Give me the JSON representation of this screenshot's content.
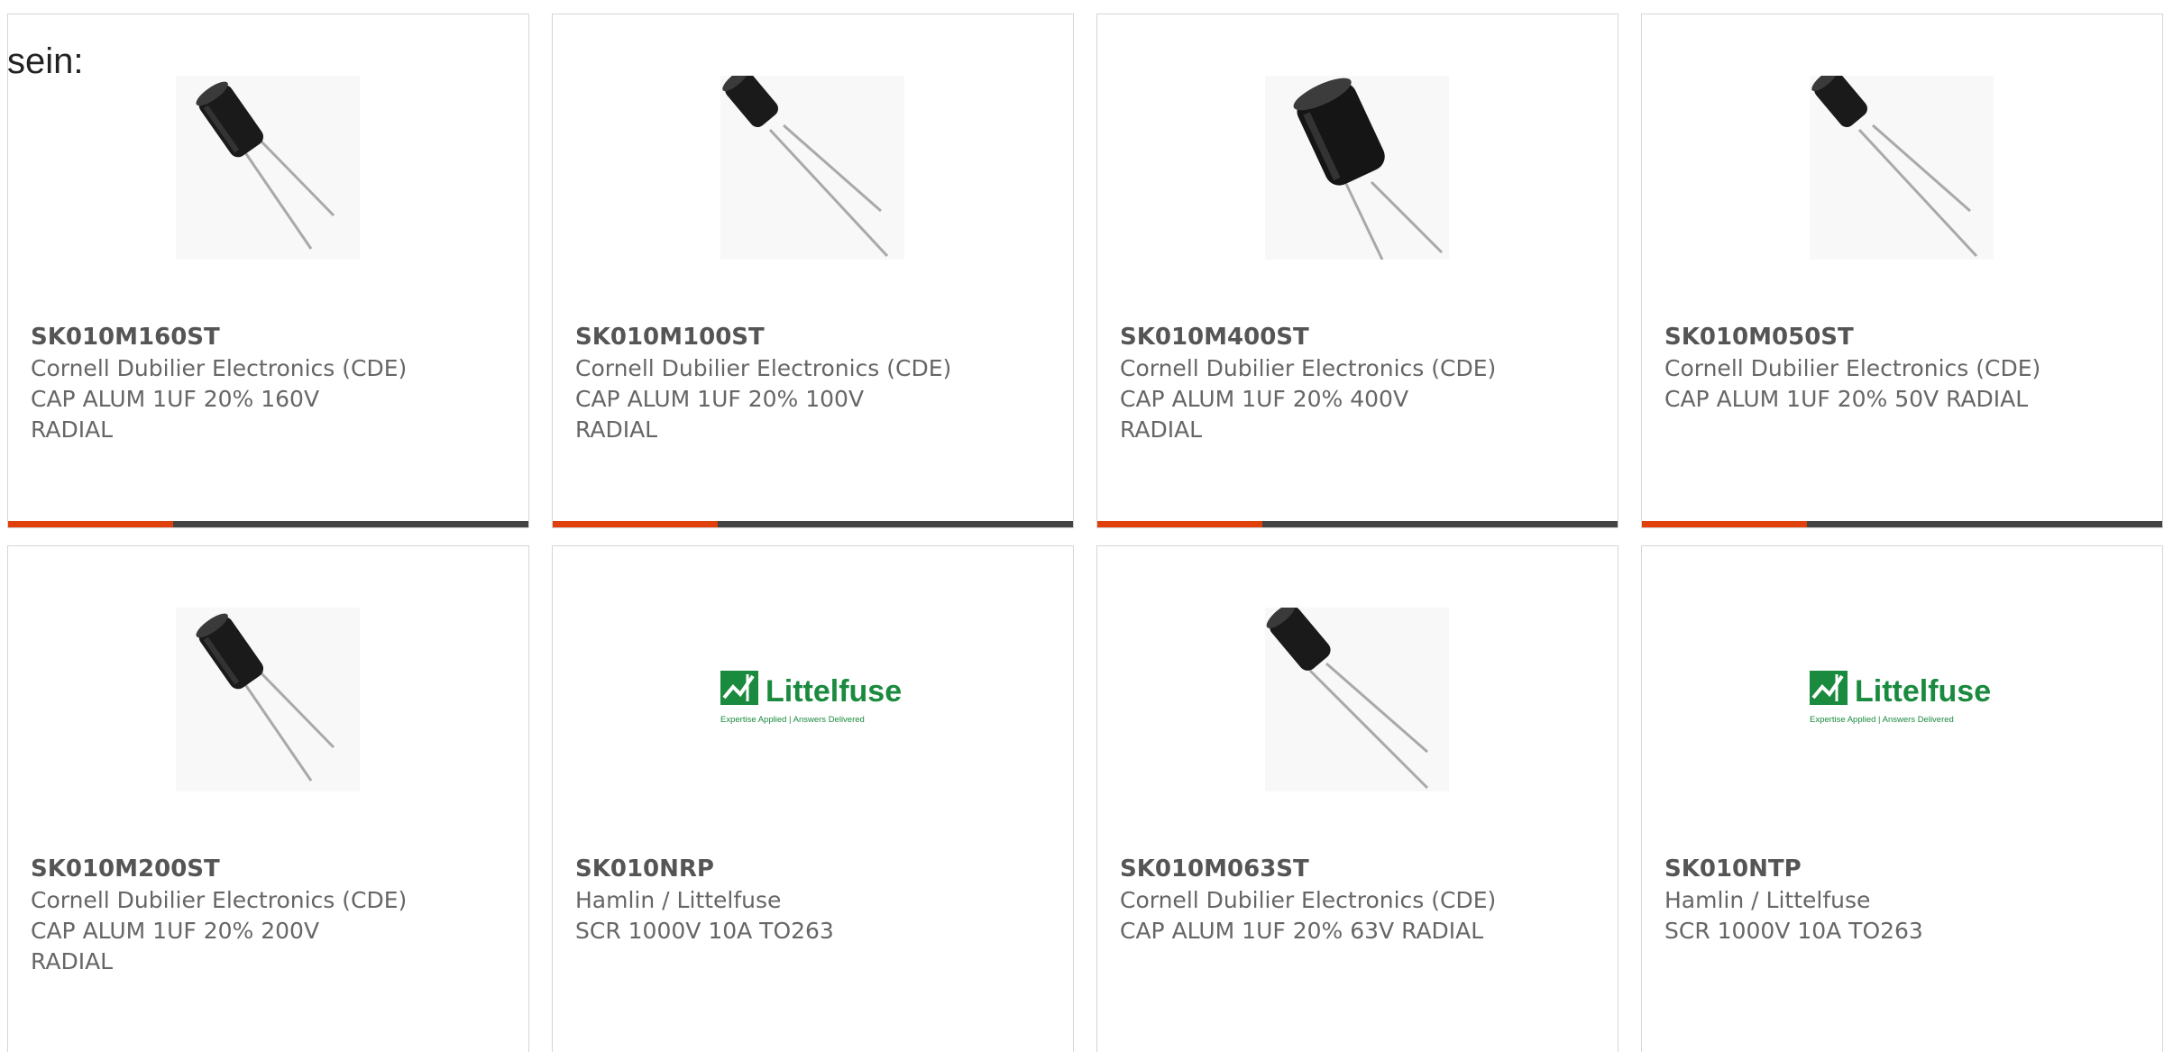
{
  "intro_text": "sein:",
  "colors": {
    "accent": "#e0400c",
    "bar_dark": "#444444",
    "logo_green": "#1a8a3e"
  },
  "cards": [
    {
      "part_number": "SK010M160ST",
      "manufacturer": "Cornell Dubilier Electronics (CDE)",
      "desc_line1": "CAP ALUM 1UF 20% 160V",
      "desc_line2": "RADIAL",
      "image": "capacitor-image"
    },
    {
      "part_number": "SK010M100ST",
      "manufacturer": "Cornell Dubilier Electronics (CDE)",
      "desc_line1": "CAP ALUM 1UF 20% 100V",
      "desc_line2": "RADIAL",
      "image": "capacitor-image"
    },
    {
      "part_number": "SK010M400ST",
      "manufacturer": "Cornell Dubilier Electronics (CDE)",
      "desc_line1": "CAP ALUM 1UF 20% 400V",
      "desc_line2": "RADIAL",
      "image": "capacitor-image"
    },
    {
      "part_number": "SK010M050ST",
      "manufacturer": "Cornell Dubilier Electronics (CDE)",
      "desc_line1": "CAP ALUM 1UF 20% 50V RADIAL",
      "desc_line2": "",
      "image": "capacitor-image"
    },
    {
      "part_number": "SK010M200ST",
      "manufacturer": "Cornell Dubilier Electronics (CDE)",
      "desc_line1": "CAP ALUM 1UF 20% 200V",
      "desc_line2": "RADIAL",
      "image": "capacitor-image"
    },
    {
      "part_number": "SK010NRP",
      "manufacturer": "Hamlin / Littelfuse",
      "desc_line1": "SCR 1000V 10A TO263",
      "desc_line2": "",
      "image": "littelfuse-logo",
      "logo_name": "Littelfuse",
      "logo_tagline": "Expertise Applied | Answers Delivered"
    },
    {
      "part_number": "SK010M063ST",
      "manufacturer": "Cornell Dubilier Electronics (CDE)",
      "desc_line1": "CAP ALUM 1UF 20% 63V RADIAL",
      "desc_line2": "",
      "image": "capacitor-image"
    },
    {
      "part_number": "SK010NTP",
      "manufacturer": "Hamlin / Littelfuse",
      "desc_line1": "SCR 1000V 10A TO263",
      "desc_line2": "",
      "image": "littelfuse-logo",
      "logo_name": "Littelfuse",
      "logo_tagline": "Expertise Applied | Answers Delivered"
    }
  ]
}
